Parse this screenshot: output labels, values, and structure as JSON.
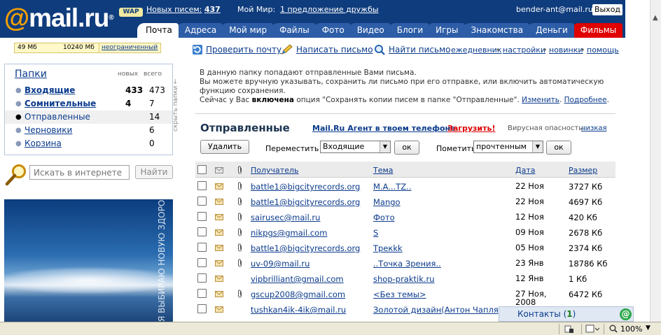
{
  "header": {
    "logo_brand": "mail.ru",
    "logo_at": "@",
    "logo_reg": "®",
    "wap_badge": "WAP",
    "new_letters_label": "Новых писем:",
    "new_letters_count": "437",
    "my_world_label": "Мой Мир:",
    "friend_offer": "1 предложение дружбы",
    "user_email": "bender-ant@mail.ru",
    "logout_label": "Выход",
    "tabs": [
      {
        "label": "Почта",
        "active": true
      },
      {
        "label": "Адреса"
      },
      {
        "label": "Мой мир"
      },
      {
        "label": "Файлы"
      },
      {
        "label": "Фото"
      },
      {
        "label": "Видео"
      },
      {
        "label": "Блоги"
      },
      {
        "label": "Игры"
      },
      {
        "label": "Знакомства"
      },
      {
        "label": "Деньги"
      },
      {
        "label": "Фильмы",
        "special": true
      }
    ]
  },
  "quota": {
    "used": "49 Мб",
    "total": "10240 Мб",
    "unlimited_link": "неограниченный"
  },
  "folders": {
    "title": "Папки",
    "col_new": "новых",
    "col_total": "всего",
    "hide_label": "скрыть папки ←",
    "items": [
      {
        "name": "Входящие",
        "new": "433",
        "total": "473",
        "bold": true
      },
      {
        "name": "Сомнительные",
        "new": "4",
        "total": "7",
        "bold": true
      },
      {
        "name": "Отправленные",
        "new": "",
        "total": "14",
        "selected": true
      },
      {
        "name": "Черновики",
        "new": "",
        "total": "6"
      },
      {
        "name": "Корзина",
        "new": "",
        "total": "0"
      }
    ]
  },
  "search": {
    "placeholder": "Искать в интернете",
    "button": "Найти"
  },
  "banner": {
    "slogan": "Я ВЫБИРАЮ НОВУЮ ЗДОРОВЬЮ"
  },
  "toolbar": {
    "check_mail": "Проверить почту",
    "write_letter": "Написать письмо",
    "find_letter": "Найти письмо",
    "diary": "ежедневник",
    "settings": "настройки",
    "news": "новинки",
    "help": "помощь"
  },
  "info": {
    "line1": "В данную папку попадают отправленные Вами письма.",
    "line2": "Вы можете вручную указывать, сохранить ли письмо при его отправке, или включить автоматическую функцию сохранения.",
    "line3_prefix": "Сейчас у Вас ",
    "line3_bold": "включена",
    "line3_suffix": " опция \"Сохранять копии писем в папке \"Отправленные\".",
    "change_link": "Изменить",
    "more_link": "Подробнее"
  },
  "folder_view": {
    "heading": "Отправленные",
    "agent_promo": "Mail.Ru Агент в твоем телефоне.",
    "download_link": "Загрузить!",
    "virus_label": "Вирусная опасность:",
    "virus_level": "низкая",
    "delete_button": "Удалить",
    "move_label": "Переместить в",
    "move_selected": "Входящие",
    "ok_label": "ок",
    "mark_label": "Пометить",
    "mark_selected": "прочтенным"
  },
  "table": {
    "columns": {
      "recipient": "Получатель",
      "subject": "Тема",
      "date": "Дата",
      "size": "Размер"
    },
    "rows": [
      {
        "to": "battle1@bigcityrecords.org",
        "subject": "M.A...TZ..",
        "date": "22 Ноя",
        "size": "3727 Кб",
        "attach": true
      },
      {
        "to": "battle1@bigcityrecords.org",
        "subject": "Mango",
        "date": "22 Ноя",
        "size": "4697 Кб",
        "attach": true
      },
      {
        "to": "sairusec@mail.ru",
        "subject": "Фото",
        "date": "12 Ноя",
        "size": "420 Кб",
        "attach": true
      },
      {
        "to": "nikpgs@gmail.com",
        "subject": "S",
        "date": "09 Ноя",
        "size": "2678 Кб",
        "attach": true
      },
      {
        "to": "battle1@bigcityrecords.org",
        "subject": "Трекkk",
        "date": "05 Ноя",
        "size": "2374 Кб",
        "attach": true
      },
      {
        "to": "uv-09@mail.ru",
        "subject": "..Точка Зрения..",
        "date": "23 Янв",
        "size": "18786 Кб",
        "attach": true
      },
      {
        "to": "vipbrilliant@gmail.com",
        "subject": "shop-praktik.ru",
        "date": "12 Янв",
        "size": "1 Кб",
        "attach": false
      },
      {
        "to": "gscup2008@gmail.com",
        "subject": "<Без темы>",
        "date": "27 Ноя, 2008",
        "size": "6472 Кб",
        "attach": true
      },
      {
        "to": "tushkan4ik-4ik@mail.ru",
        "subject": "Золотой дизайн(Антон Чапля)",
        "date": "",
        "size": "",
        "attach": false
      }
    ]
  },
  "contacts": {
    "label": "Контакты",
    "count": "1",
    "agent_icon": "@"
  },
  "status": {
    "zoom": "100%"
  },
  "colors": {
    "header_bg": "#0f3c7d",
    "accent_orange": "#f6a000",
    "link": "#0b3b8c",
    "alert_red": "#e00000"
  }
}
